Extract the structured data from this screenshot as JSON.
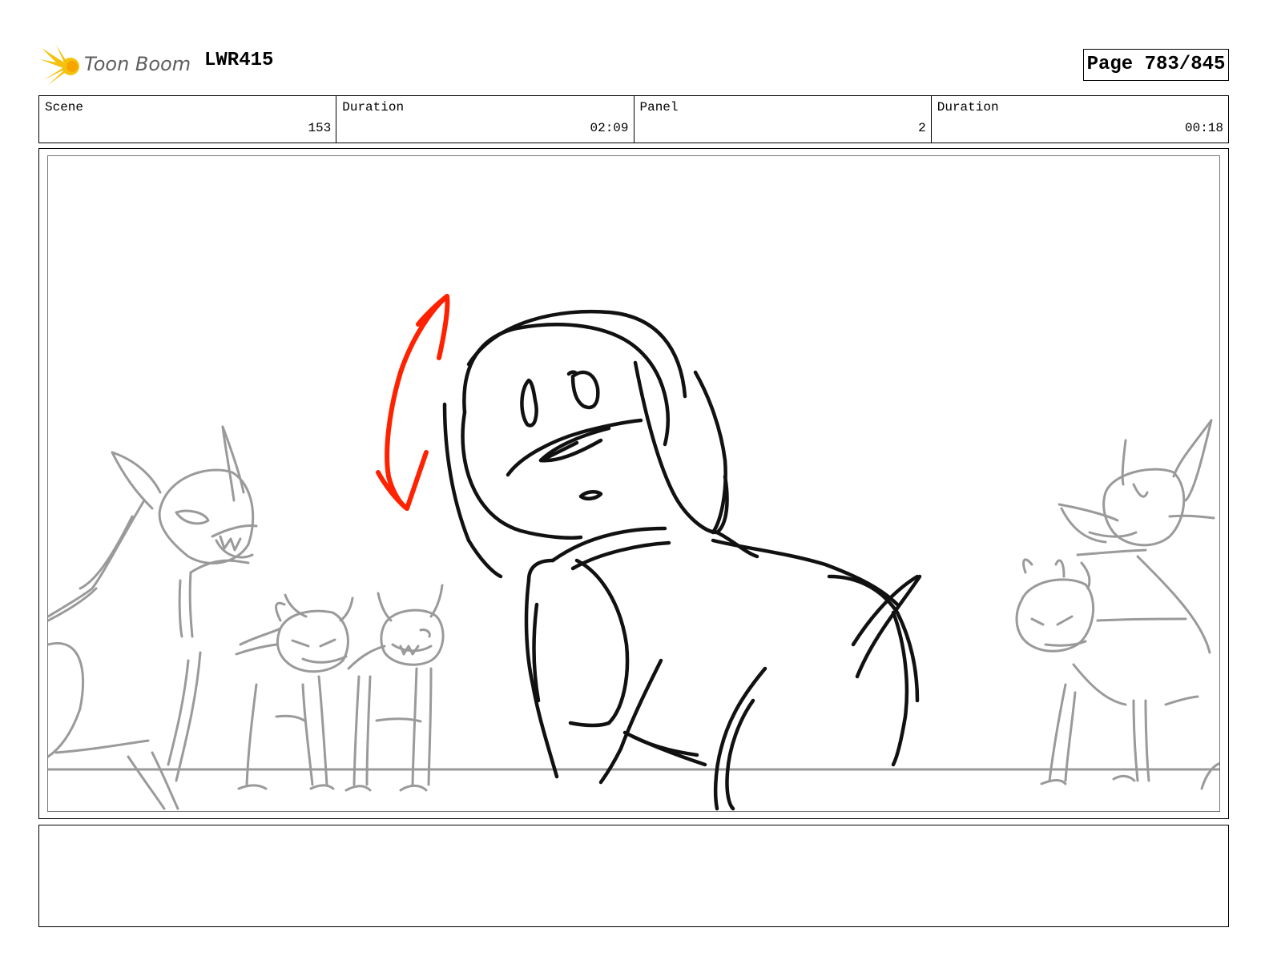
{
  "header": {
    "brand": "Toon Boom",
    "project_code": "LWR415",
    "page_label": "Page 783/845"
  },
  "info": {
    "scene_label": "Scene",
    "scene_value": "153",
    "scene_duration_label": "Duration",
    "scene_duration_value": "02:09",
    "panel_label": "Panel",
    "panel_value": "2",
    "panel_duration_label": "Duration",
    "panel_duration_value": "00:18"
  },
  "panel": {
    "sketch_colors": {
      "main": "#111111",
      "background": "#9a9a9a",
      "arrow": "#ff2200"
    },
    "icons": [
      "logo-star-icon",
      "motion-arrow-icon"
    ]
  },
  "notes": {
    "text": ""
  }
}
